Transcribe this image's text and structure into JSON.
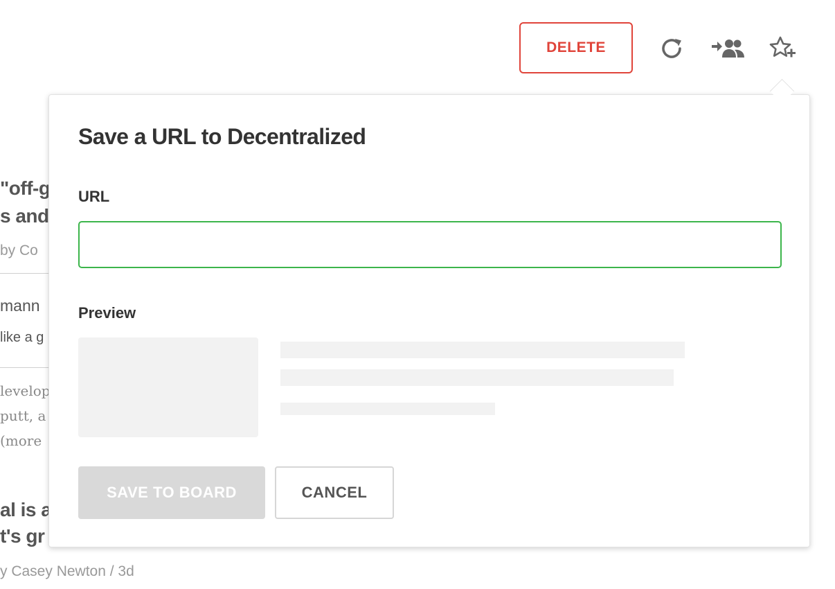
{
  "toolbar": {
    "delete_label": "DELETE",
    "refresh_icon": "refresh-icon",
    "share_icon": "share-users-icon",
    "add_favorite_icon": "star-plus-icon"
  },
  "background_feed": {
    "item1_title_line1": "\"off-g",
    "item1_title_line2": "s and",
    "item1_meta": "by Co",
    "item2_name": "mann",
    "item2_snippet": "like a g",
    "item2_body_line1": "levelop",
    "item2_body_line2": "putt, a",
    "item2_body_line3": "(more",
    "item3_title_line1": "al is a",
    "item3_title_line2": "t's gr",
    "item3_meta": "y Casey Newton / 3d"
  },
  "dialog": {
    "title": "Save a URL to Decentralized",
    "url_label": "URL",
    "url_value": "",
    "url_placeholder": "",
    "preview_label": "Preview",
    "save_label": "SAVE TO BOARD",
    "cancel_label": "CANCEL"
  },
  "colors": {
    "delete": "#e0443a",
    "input_focus": "#3cb54b",
    "disabled_button": "#d9d9d9",
    "skeleton": "#f2f2f2"
  }
}
